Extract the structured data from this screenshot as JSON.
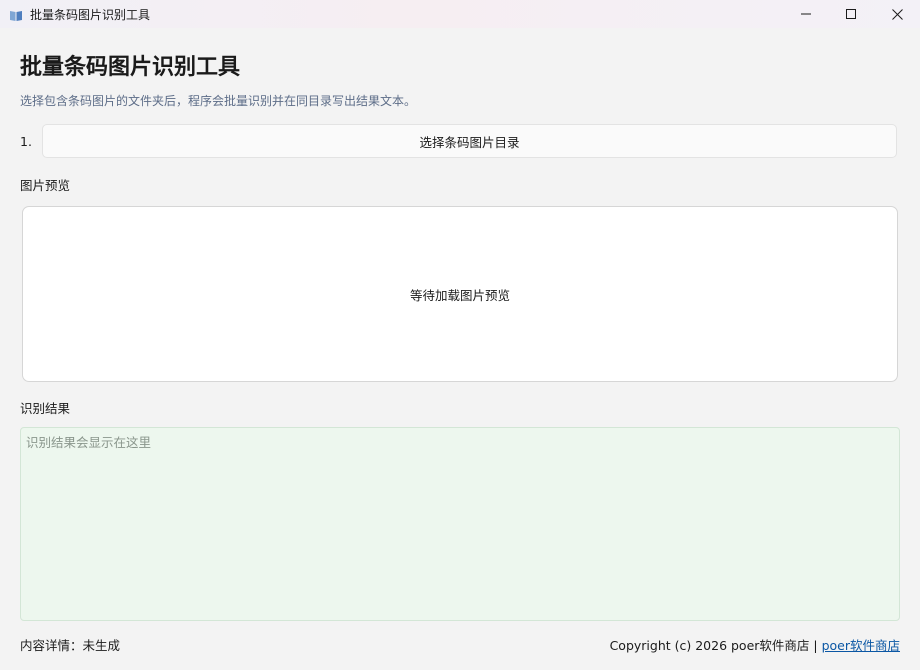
{
  "window": {
    "title": "批量条码图片识别工具",
    "icon": "book-icon",
    "controls": [
      "minimize-icon",
      "maximize-icon",
      "close-icon"
    ]
  },
  "header": {
    "title": "批量条码图片识别工具",
    "description": "选择包含条码图片的文件夹后，程序会批量识别并在同目录写出结果文本。"
  },
  "step1": {
    "number": "1.",
    "button_label": "选择条码图片目录"
  },
  "preview": {
    "label": "图片预览",
    "placeholder": "等待加载图片预览"
  },
  "result": {
    "label": "识别结果",
    "value": "",
    "placeholder": "识别结果会显示在这里"
  },
  "footer": {
    "status": "内容详情：未生成",
    "copyright": "Copyright (c) 2026 poer软件商店 | ",
    "link_text": "poer软件商店"
  },
  "colors": {
    "background": "#f3f3f3",
    "result_background": "#edf7ee",
    "description_text": "#5d6d88",
    "link": "#0b57a4"
  }
}
